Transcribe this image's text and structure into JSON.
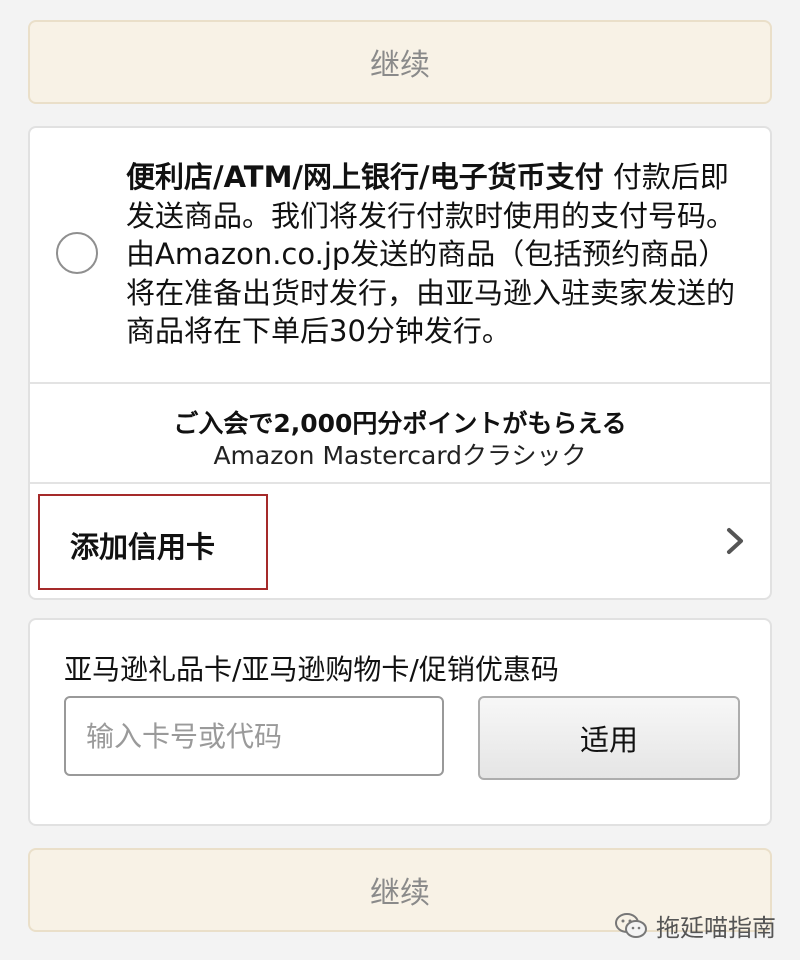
{
  "continue_top": {
    "label": "继续"
  },
  "payment_option": {
    "title": "便利店/ATM/网上银行/电子货币支付",
    "description": " 付款后即发送商品。我们将发行付款时使用的支付号码。由Amazon.co.jp发送的商品（包括预约商品）将在准备出货时发行，由亚马逊入驻卖家发送的商品将在下单后30分钟发行。",
    "selected": false
  },
  "promo": {
    "line1": "ご入会で2,000円分ポイントがもらえる",
    "line2": "Amazon Mastercardクラシック"
  },
  "add_card": {
    "label": "添加信用卡",
    "icon": "chevron-right-icon"
  },
  "gift_card": {
    "title": "亚马逊礼品卡/亚马逊购物卡/促销优惠码",
    "input_value": "",
    "input_placeholder": "输入卡号或代码",
    "apply_label": "适用"
  },
  "continue_bottom": {
    "label": "继续"
  },
  "watermark": {
    "text": "拖延喵指南",
    "icon": "wechat-icon"
  },
  "colors": {
    "continue_bg": "#f8f2e6",
    "highlight_border": "#a52a2a",
    "card_border": "#e1e1e1"
  }
}
